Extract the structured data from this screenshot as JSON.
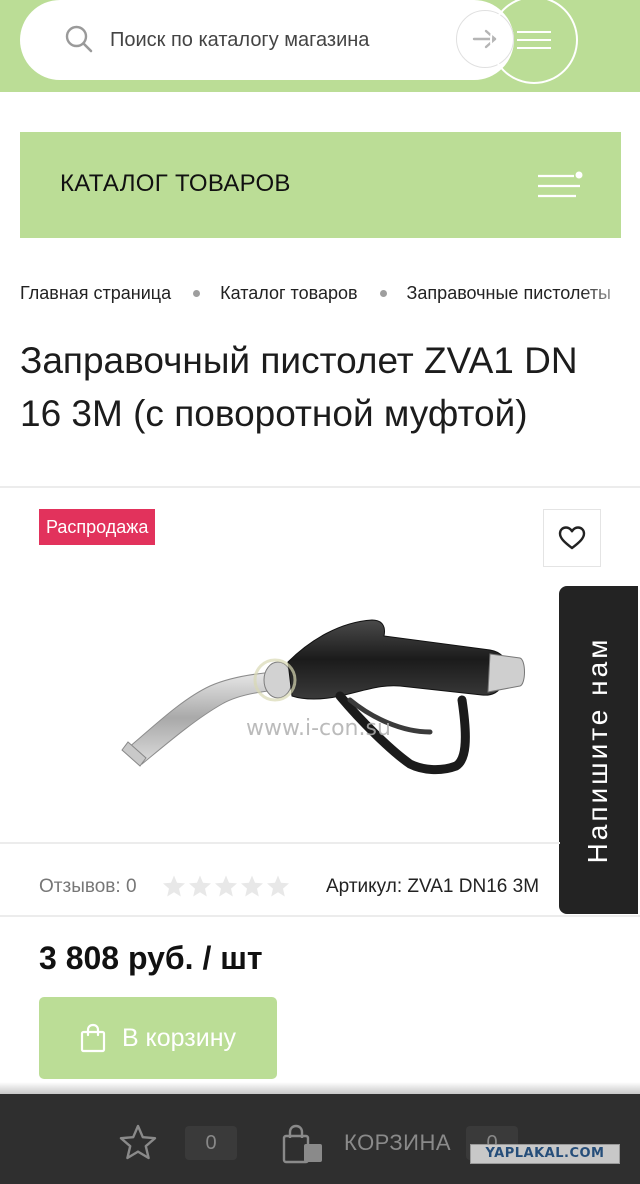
{
  "header": {
    "search": {
      "placeholder": "Поиск по каталогу магазина",
      "value": ""
    }
  },
  "catalog": {
    "title": "КАТАЛОГ ТОВАРОВ"
  },
  "breadcrumb": {
    "items": [
      "Главная страница",
      "Каталог товаров",
      "Заправочные пистолеты"
    ]
  },
  "product": {
    "title": "Заправочный пистолет ZVA1 DN 16 3M (с поворотной муфтой)",
    "badge": "Распродажа",
    "image_watermark": "www.i-con.su",
    "reviews_label": "Отзывов: 0",
    "rating": 0,
    "rating_max": 5,
    "sku": "Артикул: ZVA1 DN16 3M",
    "price": "3 808 руб. / шт",
    "add_to_cart": "В корзину"
  },
  "feedback_tab": {
    "label": "Напишите нам"
  },
  "bottom_bar": {
    "favorites_count": "0",
    "cart_label": "КОРЗИНА",
    "cart_count": "0"
  },
  "watermark": "YAPLAKAL.COM",
  "colors": {
    "accent_green": "#bbdd96",
    "sale_red": "#e2325c",
    "dark_bar": "#2f2f2f",
    "feedback_tab": "#232323"
  },
  "icons": [
    "search-icon",
    "arrow-right-icon",
    "hamburger-menu-icon",
    "heart-icon",
    "star-icon",
    "shopping-bag-icon"
  ]
}
